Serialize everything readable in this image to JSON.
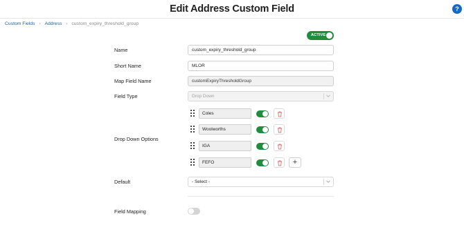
{
  "header": {
    "title": "Edit Address Custom Field",
    "help_label": "?"
  },
  "breadcrumb": {
    "items": [
      "Custom Fields",
      "Address"
    ],
    "current": "custom_expiry_threshold_group",
    "separator": "›"
  },
  "status": {
    "label": "ACTIVE",
    "on": true,
    "color": "#1e8e3e"
  },
  "form": {
    "name": {
      "label": "Name",
      "value": "custom_expiry_threshold_group"
    },
    "short_name": {
      "label": "Short Name",
      "value": "MLOR"
    },
    "map_field_name": {
      "label": "Map Field Name",
      "value": "customExpiryThresholdGroup"
    },
    "field_type": {
      "label": "Field Type",
      "value": "Drop Down"
    },
    "drop_down_options": {
      "label": "Drop Down Options",
      "options": [
        {
          "value": "Coles",
          "enabled": true
        },
        {
          "value": "Woolworths",
          "enabled": true
        },
        {
          "value": "IGA",
          "enabled": true
        },
        {
          "value": "FEFO",
          "enabled": true
        }
      ],
      "add_label": "+"
    },
    "default": {
      "label": "Default",
      "value": "- Select -"
    },
    "field_mapping": {
      "label": "Field Mapping",
      "enabled": false
    }
  },
  "colors": {
    "accent": "#1769c6",
    "toggle_on": "#1e8e3e",
    "delete": "#e05a4f"
  }
}
